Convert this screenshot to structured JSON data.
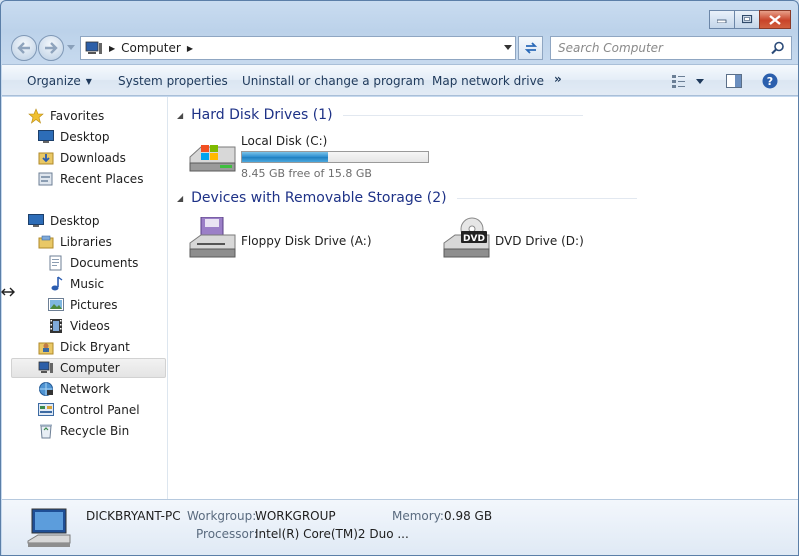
{
  "window": {
    "caption_buttons": [
      "minimize-icon",
      "maximize-icon",
      "close-icon"
    ]
  },
  "address": {
    "crumbs": [
      "Computer"
    ],
    "search_placeholder": "Search Computer"
  },
  "toolbar": {
    "organize": "Organize",
    "system_properties": "System properties",
    "uninstall": "Uninstall or change a program",
    "map_drive": "Map network drive",
    "more": "»"
  },
  "nav": {
    "favorites": "Favorites",
    "desktop_fav": "Desktop",
    "downloads": "Downloads",
    "recent": "Recent Places",
    "desktop": "Desktop",
    "libraries": "Libraries",
    "documents": "Documents",
    "music": "Music",
    "pictures": "Pictures",
    "videos": "Videos",
    "user": "Dick Bryant",
    "computer": "Computer",
    "network": "Network",
    "control_panel": "Control Panel",
    "recycle_bin": "Recycle Bin"
  },
  "groups": {
    "hdd_title": "Hard Disk Drives (1)",
    "removable_title": "Devices with Removable Storage (2)"
  },
  "drives": {
    "c_name": "Local Disk (C:)",
    "c_free": "8.45 GB free of 15.8 GB",
    "c_used_fraction": 0.465,
    "floppy_name": "Floppy Disk Drive (A:)",
    "dvd_name": "DVD Drive (D:)",
    "dvd_badge": "DVD"
  },
  "details": {
    "computer_name": "DICKBRYANT-PC",
    "workgroup_label": "Workgroup:",
    "workgroup_value": "WORKGROUP",
    "memory_label": "Memory:",
    "memory_value": "0.98 GB",
    "processor_label": "Processor:",
    "processor_value": "Intel(R) Core(TM)2 Duo ..."
  },
  "colors": {
    "accent": "#1e3287",
    "bar_fill": "#2b8ccf"
  }
}
